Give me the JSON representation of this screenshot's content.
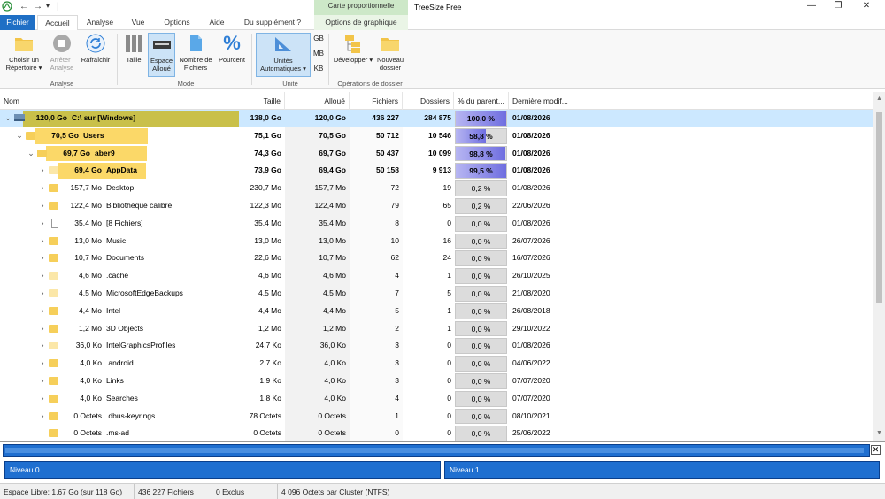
{
  "app": {
    "title": "TreeSize Free",
    "context_group": "Carte proportionnelle"
  },
  "tabs": [
    {
      "label": "Fichier"
    },
    {
      "label": "Accueil"
    },
    {
      "label": "Analyse"
    },
    {
      "label": "Vue"
    },
    {
      "label": "Options"
    },
    {
      "label": "Aide"
    },
    {
      "label": "Du supplément ?"
    },
    {
      "label": "Options de graphique"
    }
  ],
  "ribbon": {
    "choose_dir": "Choisir un Répertoire ▾",
    "stop": "Arrêter l Analyse",
    "refresh": "Rafraîchir",
    "group_analyse": "Analyse",
    "size": "Taille",
    "alloc": "Espace Alloué",
    "nfiles": "Nombre de Fichiers",
    "percent": "Pourcent",
    "group_mode": "Mode",
    "units": "Unités Automatiques ▾",
    "gb": "GB",
    "mb": "MB",
    "kb": "KB",
    "group_unit": "Unité",
    "expand": "Développer ▾",
    "newfolder": "Nouveau dossier",
    "group_ops": "Opérations de dossier"
  },
  "columns": {
    "name": "Nom",
    "size": "Taille",
    "alloc": "Alloué",
    "files": "Fichiers",
    "folders": "Dossiers",
    "pct": "% du parent...",
    "date": "Dernière modif..."
  },
  "rows": [
    {
      "level": 0,
      "bar": "120,0 Go",
      "name": "C:\\  sur  [Windows]",
      "size": "138,0 Go",
      "alloc": "120,0 Go",
      "files": "436 227",
      "folders": "284 875",
      "pct": "100,0 %",
      "pct_value": 100,
      "date": "01/08/2026",
      "bold": true,
      "expanded": true,
      "icon": "drive"
    },
    {
      "level": 1,
      "bar": "70,5 Go",
      "name": "Users",
      "size": "75,1 Go",
      "alloc": "70,5 Go",
      "files": "50 712",
      "folders": "10 546",
      "pct": "58,8 %",
      "pct_value": 58.8,
      "date": "01/08/2026",
      "bold": true,
      "expanded": true,
      "icon": "folder"
    },
    {
      "level": 2,
      "bar": "69,7 Go",
      "name": "aber9",
      "size": "74,3 Go",
      "alloc": "69,7 Go",
      "files": "50 437",
      "folders": "10 099",
      "pct": "98,8 %",
      "pct_value": 98.8,
      "date": "01/08/2026",
      "bold": true,
      "expanded": true,
      "icon": "folder"
    },
    {
      "level": 3,
      "bar": "69,4 Go",
      "name": "AppData",
      "size": "73,9 Go",
      "alloc": "69,4 Go",
      "files": "50 158",
      "folders": "9 913",
      "pct": "99,5 %",
      "pct_value": 99.5,
      "date": "01/08/2026",
      "bold": true,
      "expanded": false,
      "icon": "folder-light"
    },
    {
      "level": 3,
      "bar": "157,7 Mo",
      "name": "Desktop",
      "size": "230,7 Mo",
      "alloc": "157,7 Mo",
      "files": "72",
      "folders": "19",
      "pct": "0,2 %",
      "pct_value": 0.2,
      "date": "01/08/2026",
      "icon": "folder"
    },
    {
      "level": 3,
      "bar": "122,4 Mo",
      "name": "Bibliothèque calibre",
      "size": "122,3 Mo",
      "alloc": "122,4 Mo",
      "files": "79",
      "folders": "65",
      "pct": "0,2 %",
      "pct_value": 0.2,
      "date": "22/06/2026",
      "icon": "folder"
    },
    {
      "level": 3,
      "bar": "35,4 Mo",
      "name": "[8 Fichiers]",
      "size": "35,4 Mo",
      "alloc": "35,4 Mo",
      "files": "8",
      "folders": "0",
      "pct": "0,0 %",
      "pct_value": 0,
      "date": "01/08/2026",
      "icon": "file"
    },
    {
      "level": 3,
      "bar": "13,0 Mo",
      "name": "Music",
      "size": "13,0 Mo",
      "alloc": "13,0 Mo",
      "files": "10",
      "folders": "16",
      "pct": "0,0 %",
      "pct_value": 0,
      "date": "26/07/2026",
      "icon": "folder"
    },
    {
      "level": 3,
      "bar": "10,7 Mo",
      "name": "Documents",
      "size": "22,6 Mo",
      "alloc": "10,7 Mo",
      "files": "62",
      "folders": "24",
      "pct": "0,0 %",
      "pct_value": 0,
      "date": "16/07/2026",
      "icon": "folder"
    },
    {
      "level": 3,
      "bar": "4,6 Mo",
      "name": ".cache",
      "size": "4,6 Mo",
      "alloc": "4,6 Mo",
      "files": "4",
      "folders": "1",
      "pct": "0,0 %",
      "pct_value": 0,
      "date": "26/10/2025",
      "icon": "folder-light"
    },
    {
      "level": 3,
      "bar": "4,5 Mo",
      "name": "MicrosoftEdgeBackups",
      "size": "4,5 Mo",
      "alloc": "4,5 Mo",
      "files": "7",
      "folders": "5",
      "pct": "0,0 %",
      "pct_value": 0,
      "date": "21/08/2020",
      "icon": "folder-light"
    },
    {
      "level": 3,
      "bar": "4,4 Mo",
      "name": "Intel",
      "size": "4,4 Mo",
      "alloc": "4,4 Mo",
      "files": "5",
      "folders": "1",
      "pct": "0,0 %",
      "pct_value": 0,
      "date": "26/08/2018",
      "icon": "folder"
    },
    {
      "level": 3,
      "bar": "1,2 Mo",
      "name": "3D Objects",
      "size": "1,2 Mo",
      "alloc": "1,2 Mo",
      "files": "2",
      "folders": "1",
      "pct": "0,0 %",
      "pct_value": 0,
      "date": "29/10/2022",
      "icon": "folder"
    },
    {
      "level": 3,
      "bar": "36,0 Ko",
      "name": "IntelGraphicsProfiles",
      "size": "24,7 Ko",
      "alloc": "36,0 Ko",
      "files": "3",
      "folders": "0",
      "pct": "0,0 %",
      "pct_value": 0,
      "date": "01/08/2026",
      "icon": "folder-light"
    },
    {
      "level": 3,
      "bar": "4,0 Ko",
      "name": ".android",
      "size": "2,7 Ko",
      "alloc": "4,0 Ko",
      "files": "3",
      "folders": "0",
      "pct": "0,0 %",
      "pct_value": 0,
      "date": "04/06/2022",
      "icon": "folder"
    },
    {
      "level": 3,
      "bar": "4,0 Ko",
      "name": "Links",
      "size": "1,9 Ko",
      "alloc": "4,0 Ko",
      "files": "3",
      "folders": "0",
      "pct": "0,0 %",
      "pct_value": 0,
      "date": "07/07/2020",
      "icon": "folder"
    },
    {
      "level": 3,
      "bar": "4,0 Ko",
      "name": "Searches",
      "size": "1,8 Ko",
      "alloc": "4,0 Ko",
      "files": "4",
      "folders": "0",
      "pct": "0,0 %",
      "pct_value": 0,
      "date": "07/07/2020",
      "icon": "folder"
    },
    {
      "level": 3,
      "bar": "0 Octets",
      "name": ".dbus-keyrings",
      "size": "78 Octets",
      "alloc": "0 Octets",
      "files": "1",
      "folders": "0",
      "pct": "0,0 %",
      "pct_value": 0,
      "date": "08/10/2021",
      "icon": "folder"
    },
    {
      "level": 3,
      "bar": "0 Octets",
      "name": ".ms-ad",
      "size": "0 Octets",
      "alloc": "0 Octets",
      "files": "0",
      "folders": "0",
      "pct": "0,0 %",
      "pct_value": 0,
      "date": "25/06/2022",
      "icon": "folder",
      "noexpand": true
    }
  ],
  "levels": {
    "l0": "Niveau 0",
    "l1": "Niveau 1"
  },
  "status": {
    "free": "Espace Libre: 1,67 Go  (sur 118 Go)",
    "files": "436 227 Fichiers",
    "excluded": "0 Exclus",
    "cluster": "4 096 Octets par Cluster (NTFS)"
  }
}
